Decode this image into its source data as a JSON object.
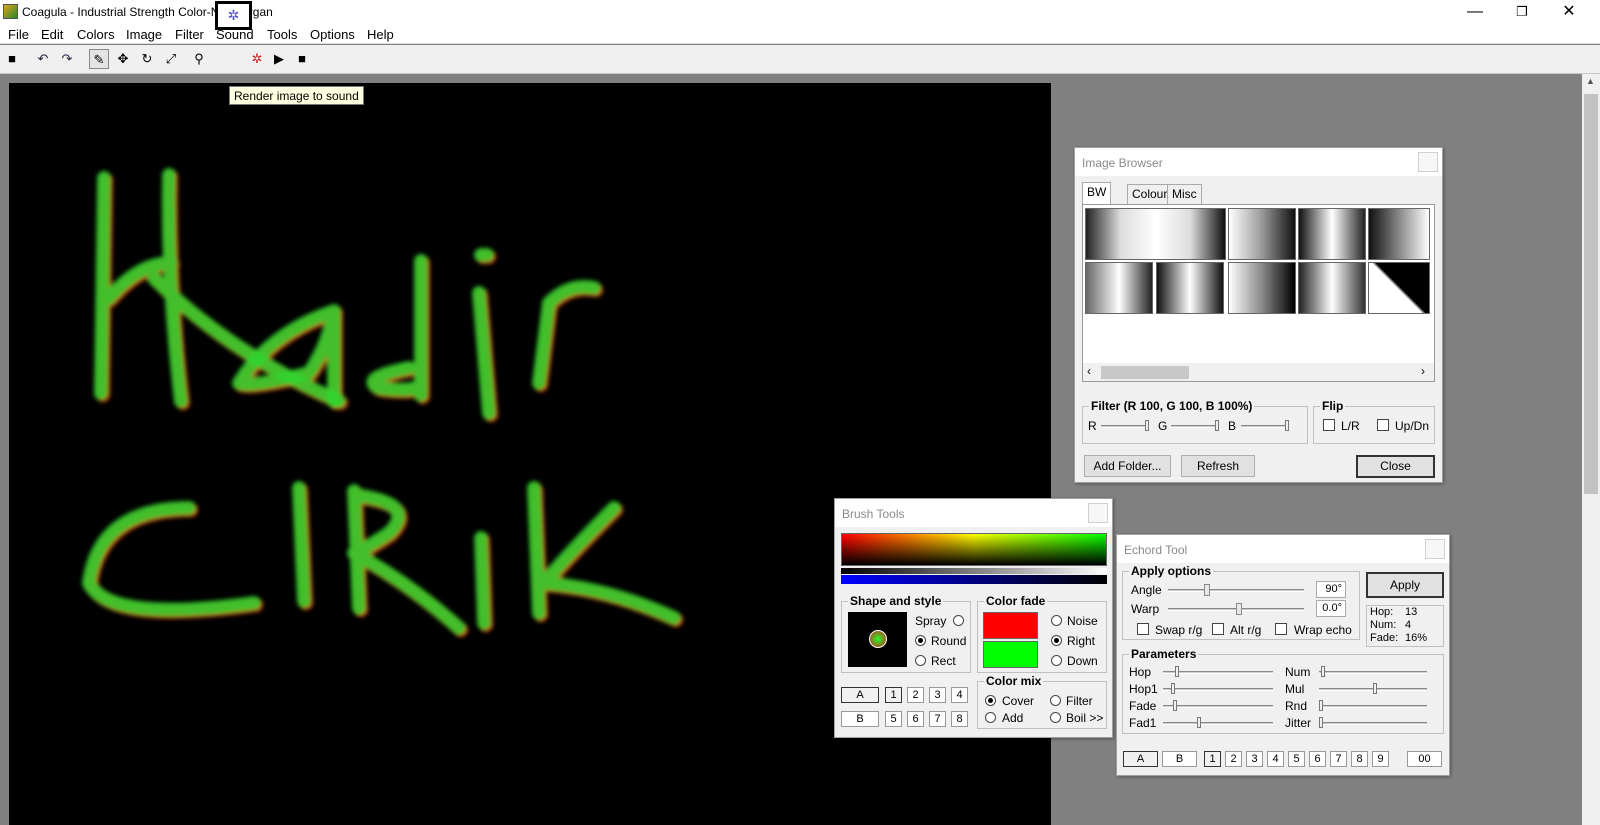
{
  "window": {
    "title": "Coagula - Industrial Strength Color-Note Organ",
    "minimize": "—",
    "restore": "❐",
    "close": "✕"
  },
  "menu": [
    "File",
    "Edit",
    "Colors",
    "Image",
    "Filter",
    "Sound",
    "Tools",
    "Options",
    "Help"
  ],
  "tooltip": "Render image to sound",
  "image_browser": {
    "title": "Image Browser",
    "tabs": [
      "BW",
      "Colour",
      "Misc"
    ],
    "filter_label": "Filter (R 100, G 100, B 100%)",
    "filter_channels": [
      "R",
      "G",
      "B"
    ],
    "flip_label": "Flip",
    "flip_options": [
      "L/R",
      "Up/Dn"
    ],
    "buttons": {
      "add_folder": "Add Folder...",
      "refresh": "Refresh",
      "close": "Close"
    }
  },
  "brush_tools": {
    "title": "Brush Tools",
    "shape_label": "Shape and style",
    "shape_options": [
      {
        "label": "Spray",
        "selected": false
      },
      {
        "label": "Round",
        "selected": true
      },
      {
        "label": "Rect",
        "selected": false
      }
    ],
    "fade_label": "Color fade",
    "fade_options": [
      {
        "label": "Noise",
        "selected": false
      },
      {
        "label": "Right",
        "selected": true
      },
      {
        "label": "Down",
        "selected": false
      }
    ],
    "mix_label": "Color mix",
    "mix_options": [
      {
        "label": "Cover",
        "selected": true
      },
      {
        "label": "Filter",
        "selected": false
      },
      {
        "label": "Add",
        "selected": false
      },
      {
        "label": "Boil >>",
        "selected": false
      }
    ],
    "ab": [
      "A",
      "B"
    ],
    "slots_top": [
      "1",
      "2",
      "3",
      "4"
    ],
    "slots_bottom": [
      "5",
      "6",
      "7",
      "8"
    ],
    "fade_colors": {
      "top": "#ff0000",
      "bottom": "#00ff00"
    }
  },
  "echord_tool": {
    "title": "Echord Tool",
    "apply_options_label": "Apply options",
    "angle_label": "Angle",
    "angle_value": "90°",
    "warp_label": "Warp",
    "warp_value": "0.0°",
    "checkboxes": [
      "Swap r/g",
      "Alt r/g",
      "Wrap echo"
    ],
    "apply_button": "Apply",
    "stats": [
      {
        "k": "Hop:",
        "v": "13"
      },
      {
        "k": "Num:",
        "v": "4"
      },
      {
        "k": "Fade:",
        "v": "16%"
      }
    ],
    "parameters_label": "Parameters",
    "params_left": [
      "Hop",
      "Hop1",
      "Fade",
      "Fad1"
    ],
    "params_right": [
      "Num",
      "Mul",
      "Rnd",
      "Jitter"
    ],
    "ab": [
      "A",
      "B"
    ],
    "slots": [
      "1",
      "2",
      "3",
      "4",
      "5",
      "6",
      "7",
      "8",
      "9"
    ],
    "extra": "00"
  },
  "canvas_text": [
    "Kadir",
    "CIRIK"
  ],
  "colors": {
    "stroke_green": "#2fd62f",
    "stroke_red": "#e0401a"
  }
}
